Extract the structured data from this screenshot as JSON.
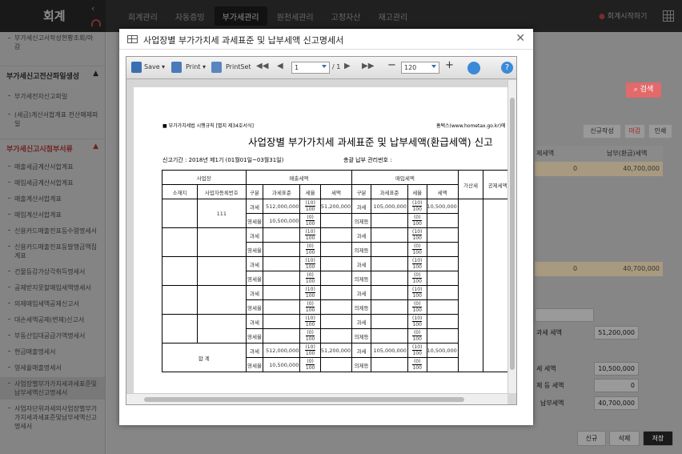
{
  "app": {
    "logo": "회계"
  },
  "topnav": {
    "items": [
      "회계관리",
      "자동증빙",
      "부가세관리",
      "원천세관리",
      "고정자산",
      "재고관리"
    ],
    "active_index": 2,
    "right_label": "회계시작하기"
  },
  "sidebar": {
    "top_item": "부가세신고서작성현황조회/마감",
    "sections": [
      {
        "title": "부가세신고전산파일생성",
        "chevron": "▲",
        "color": "#333333",
        "items": [
          "부가세전자신고파일",
          "(세금)계산서합계표 전산매체파일"
        ]
      },
      {
        "title": "부가세신고시첨부서류",
        "chevron": "▲",
        "color": "#d04040",
        "items": [
          "매출세금계산서합계표",
          "매입세금계산서합계표",
          "매출계산서합계표",
          "매입계산서합계표",
          "신용카드매출전표등수령명세서",
          "신용카드매출전표등발행금액집계표",
          "건물등감가상각취득명세서",
          "공제받지못할매입세액명세서",
          "의제매입세액공제신고서",
          "대손세액공제(변제)신고서",
          "부동산임대공급가액명세서",
          "현금매출명세서",
          "영세율매출명세서",
          "사업장별부가가치세과세표준및납부세액신고명세서",
          "사업자단위과세의사업장별부가가치세과세표준및납부세액신고명세서"
        ]
      }
    ],
    "selected_item": "사업장별부가가치세과세표준및납부세액신고명세서"
  },
  "background": {
    "search_button": "검색",
    "action_buttons": [
      "신규작성",
      "마감",
      "인쇄"
    ],
    "table_headers": [
      "제세액",
      "납부(환급)세액"
    ],
    "row1": [
      "0",
      "40,700,000"
    ],
    "row2": [
      "0",
      "40,700,000"
    ],
    "fields": [
      {
        "label": "과세 세액",
        "value": "51,200,000"
      },
      {
        "label": "세 세액",
        "value": "10,500,000"
      },
      {
        "label": "제 등 세액",
        "value": "0"
      },
      {
        "label": "납부세액",
        "value": "40,700,000"
      }
    ],
    "bottom_buttons": [
      "신규",
      "삭제",
      "저장"
    ]
  },
  "modal": {
    "title": "사업장별 부가가치세 과세표준 및 납부세액 신고명세서",
    "toolbar": {
      "save": "Save",
      "print": "Print",
      "printset": "PrintSet",
      "page_current": "1",
      "page_total": "/ 1",
      "zoom": "120"
    },
    "document": {
      "form_label": "■ 부가가치세법 시행규칙 [별지 제34호서식]",
      "source": "홈택스(www.hometax.go.kr)에",
      "title": "사업장별 부가가치세 과세표준 및 납부세액(환급세액) 신고",
      "period_label": "신고기간 :   2018년 제1기 (01월01일~03월31일)",
      "mgmt_label": "총괄 납부 관리번호 :",
      "headers": {
        "business": "사업장",
        "sales_tax": "매출세액",
        "purchase_tax": "매입세액",
        "additional": "가산세",
        "deduction": "공제세액",
        "location": "소재지",
        "reg_no": "사업자등록번호",
        "type": "구분",
        "tax_base": "과세표준",
        "rate": "세율",
        "tax": "세액"
      },
      "rate_tax": {
        "num": "10",
        "den": "100"
      },
      "rate_zero": {
        "num": "0",
        "den": "100"
      },
      "row_types": {
        "taxable": "과세",
        "zero_rate": "영세율",
        "deemed": "의제등"
      },
      "first_row": {
        "reg_no": "111",
        "sales_taxable_base": "512,000,000",
        "sales_tax": "51,200,000",
        "sales_zero_base": "10,500,000",
        "purchase_taxable_base": "105,000,000",
        "purchase_tax": "10,500,000"
      },
      "total_label": "합 계",
      "total_row": {
        "sales_taxable_base": "512,000,000",
        "sales_tax": "51,200,000",
        "sales_zero_base": "10,500,000",
        "purchase_taxable_base": "105,000,000",
        "purchase_tax": "10,500,000"
      }
    }
  }
}
